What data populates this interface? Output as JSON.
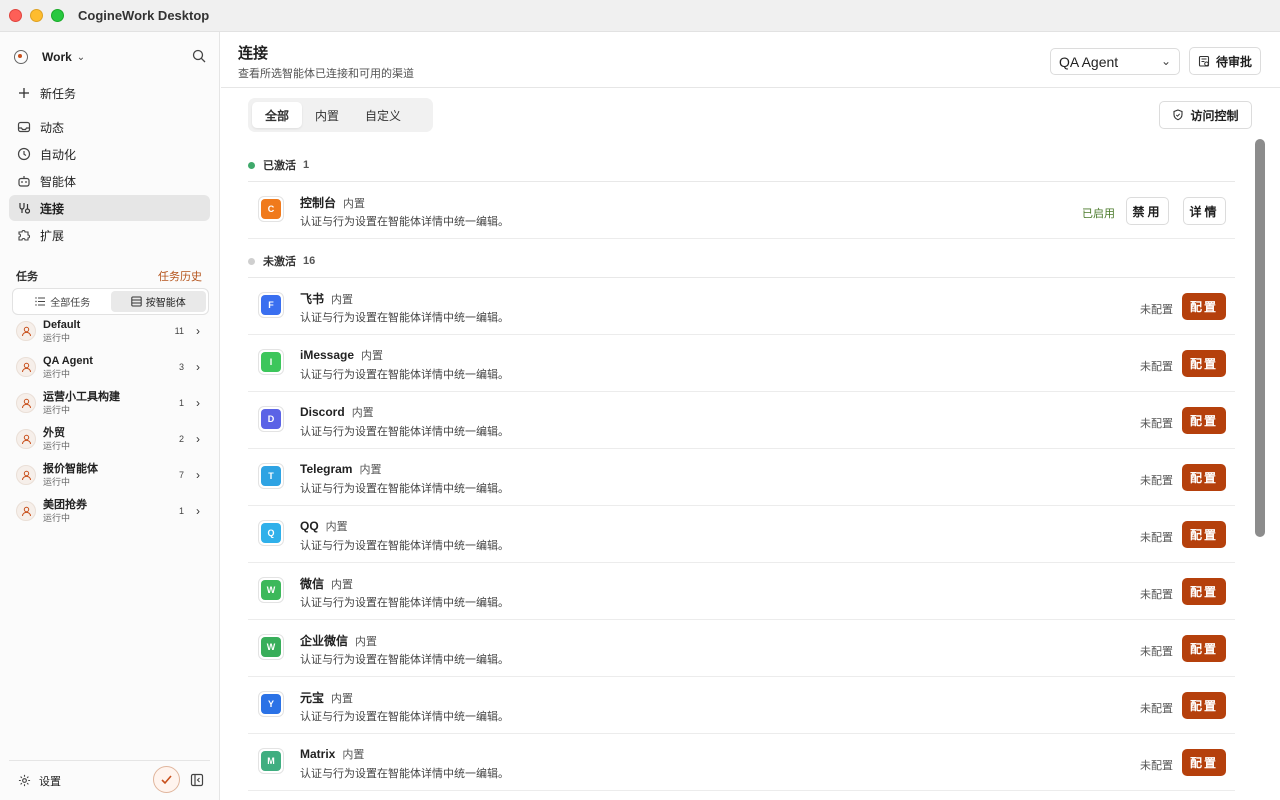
{
  "window": {
    "title": "CogineWork Desktop"
  },
  "sidebar": {
    "workspace": "Work",
    "nav": [
      {
        "label": "新任务",
        "icon": "plus-icon"
      },
      {
        "label": "动态",
        "icon": "inbox-icon"
      },
      {
        "label": "自动化",
        "icon": "clock-icon"
      },
      {
        "label": "智能体",
        "icon": "robot-icon"
      },
      {
        "label": "连接",
        "icon": "connection-icon"
      },
      {
        "label": "扩展",
        "icon": "puzzle-icon"
      }
    ],
    "tasks_label": "任务",
    "history_link": "任务历史",
    "filter": {
      "all": "全部任务",
      "by_agent": "按智能体"
    },
    "agents": [
      {
        "name": "Default",
        "status": "运行中",
        "count": "11"
      },
      {
        "name": "QA Agent",
        "status": "运行中",
        "count": "3"
      },
      {
        "name": "运营小工具构建",
        "status": "运行中",
        "count": "1"
      },
      {
        "name": "外贸",
        "status": "运行中",
        "count": "2"
      },
      {
        "name": "报价智能体",
        "status": "运行中",
        "count": "7"
      },
      {
        "name": "美团抢券",
        "status": "运行中",
        "count": "1"
      }
    ],
    "settings_label": "设置"
  },
  "header": {
    "title": "连接",
    "subtitle": "查看所选智能体已连接和可用的渠道",
    "agent_select": "QA Agent",
    "pending_label": "待审批"
  },
  "content": {
    "tabs": [
      "全部",
      "内置",
      "自定义"
    ],
    "access_label": "访问控制",
    "active_group": {
      "label": "已激活",
      "count": "1",
      "color": "#3fa96b"
    },
    "inactive_group": {
      "label": "未激活",
      "count": "16",
      "color": "#cfcfcf"
    },
    "active": [
      {
        "name": "控制台",
        "tag": "内置",
        "desc": "认证与行为设置在智能体详情中统一编辑。",
        "letter": "C",
        "color": "#f07a1c",
        "status": "已启用",
        "disable": "禁用",
        "details": "详情"
      }
    ],
    "inactive": [
      {
        "name": "飞书",
        "tag": "内置",
        "desc": "认证与行为设置在智能体详情中统一编辑。",
        "letter": "F",
        "color": "#3a6ff0"
      },
      {
        "name": "iMessage",
        "tag": "内置",
        "desc": "认证与行为设置在智能体详情中统一编辑。",
        "letter": "I",
        "color": "#3cc65b"
      },
      {
        "name": "Discord",
        "tag": "内置",
        "desc": "认证与行为设置在智能体详情中统一编辑。",
        "letter": "D",
        "color": "#5b63e6"
      },
      {
        "name": "Telegram",
        "tag": "内置",
        "desc": "认证与行为设置在智能体详情中统一编辑。",
        "letter": "T",
        "color": "#2ea3e3"
      },
      {
        "name": "QQ",
        "tag": "内置",
        "desc": "认证与行为设置在智能体详情中统一编辑。",
        "letter": "Q",
        "color": "#2fb0ea"
      },
      {
        "name": "微信",
        "tag": "内置",
        "desc": "认证与行为设置在智能体详情中统一编辑。",
        "letter": "W",
        "color": "#3cb85a"
      },
      {
        "name": "企业微信",
        "tag": "内置",
        "desc": "认证与行为设置在智能体详情中统一编辑。",
        "letter": "W",
        "color": "#38ae5a"
      },
      {
        "name": "元宝",
        "tag": "内置",
        "desc": "认证与行为设置在智能体详情中统一编辑。",
        "letter": "Y",
        "color": "#2b72e6"
      },
      {
        "name": "Matrix",
        "tag": "内置",
        "desc": "认证与行为设置在智能体详情中统一编辑。",
        "letter": "M",
        "color": "#3fae80"
      }
    ],
    "not_configured": "未配置",
    "configure": "配置"
  }
}
